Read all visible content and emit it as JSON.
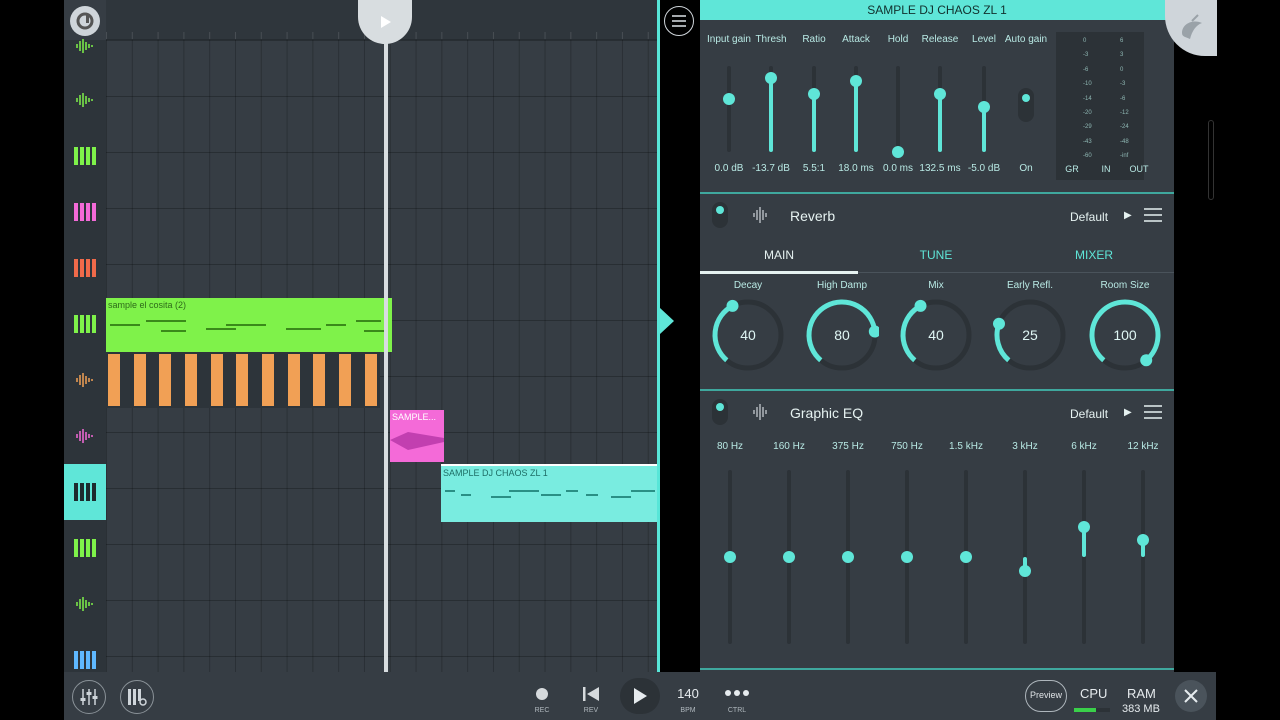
{
  "plugin": {
    "title": "SAMPLE DJ CHAOS ZL 1",
    "compressor": {
      "controls": [
        {
          "label": "Input gain",
          "value": "0.0 dB",
          "level": 0.62
        },
        {
          "label": "Thresh",
          "value": "-13.7 dB",
          "level": 0.86
        },
        {
          "label": "Ratio",
          "value": "5.5:1",
          "level": 0.67
        },
        {
          "label": "Attack",
          "value": "18.0 ms",
          "level": 0.82
        },
        {
          "label": "Hold",
          "value": "0.0 ms",
          "level": 0.0
        },
        {
          "label": "Release",
          "value": "132.5 ms",
          "level": 0.67
        },
        {
          "label": "Level",
          "value": "-5.0 dB",
          "level": 0.52
        },
        {
          "label": "Auto gain",
          "value": "On",
          "level": 1.0
        }
      ],
      "meter": {
        "left_ticks": [
          "0",
          "-3",
          "-6",
          "-10",
          "-14",
          "-20",
          "-29",
          "-43",
          "-60"
        ],
        "right_ticks": [
          "6",
          "3",
          "0",
          "-3",
          "-6",
          "-12",
          "-24",
          "-48",
          "-inf"
        ],
        "labels": [
          "GR",
          "IN",
          "OUT"
        ]
      }
    },
    "reverb": {
      "name": "Reverb",
      "preset": "Default",
      "tabs": [
        "MAIN",
        "TUNE",
        "MIXER"
      ],
      "active_tab": "MAIN",
      "dials": [
        {
          "label": "Decay",
          "value": "40",
          "level": 0.4
        },
        {
          "label": "High Damp",
          "value": "80",
          "level": 0.8
        },
        {
          "label": "Mix",
          "value": "40",
          "level": 0.4
        },
        {
          "label": "Early Refl.",
          "value": "25",
          "level": 0.25
        },
        {
          "label": "Room Size",
          "value": "100",
          "level": 1.0
        }
      ]
    },
    "eq": {
      "name": "Graphic EQ",
      "preset": "Default",
      "bands": [
        {
          "label": "80 Hz",
          "level": 0.5
        },
        {
          "label": "160 Hz",
          "level": 0.5
        },
        {
          "label": "375 Hz",
          "level": 0.5
        },
        {
          "label": "750 Hz",
          "level": 0.5
        },
        {
          "label": "1.5 kHz",
          "level": 0.5
        },
        {
          "label": "3 kHz",
          "level": 0.42
        },
        {
          "label": "6 kHz",
          "level": 0.67
        },
        {
          "label": "12 kHz",
          "level": 0.6
        }
      ]
    }
  },
  "playlist": {
    "clips": {
      "green": "sample el cosita (2)",
      "pink": "SAMPLE...",
      "cyan": "SAMPLE DJ CHAOS ZL 1"
    }
  },
  "toolbar": {
    "rec": "REC",
    "rev": "REV",
    "bpm_value": "140",
    "bpm": "BPM",
    "ctrl": "CTRL",
    "preview": "Preview",
    "cpu": "CPU",
    "ram": "RAM",
    "ram_value": "383 MB"
  },
  "colors": {
    "accent": "#5fe6d8",
    "panel": "#363d44",
    "green_clip": "#7ff24a",
    "pink_clip": "#f46ad8",
    "orange_clip": "#f1a055"
  }
}
